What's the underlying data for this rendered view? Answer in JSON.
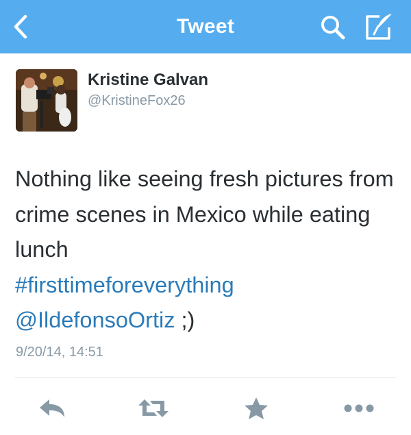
{
  "navbar": {
    "title": "Tweet",
    "background": "#55acee",
    "icons": {
      "back": "back-chevron-icon",
      "search": "search-icon",
      "compose": "compose-icon"
    }
  },
  "tweet": {
    "author": {
      "display_name": "Kristine Galvan",
      "handle": "@KristineFox26"
    },
    "text_plain": "Nothing like seeing fresh pictures from crime scenes in Mexico while eating lunch",
    "hashtag": "#firsttimeforeverything",
    "mention": "@IldefonsoOrtiz",
    "text_suffix": " ;)",
    "timestamp": "9/20/14, 14:51"
  },
  "actions": {
    "icons": [
      "reply-icon",
      "retweet-icon",
      "favorite-star-icon",
      "more-options-icon"
    ],
    "color": "#8899a6"
  },
  "colors": {
    "link": "#2b7bb9",
    "text": "#292f33",
    "muted": "#8899a6"
  }
}
